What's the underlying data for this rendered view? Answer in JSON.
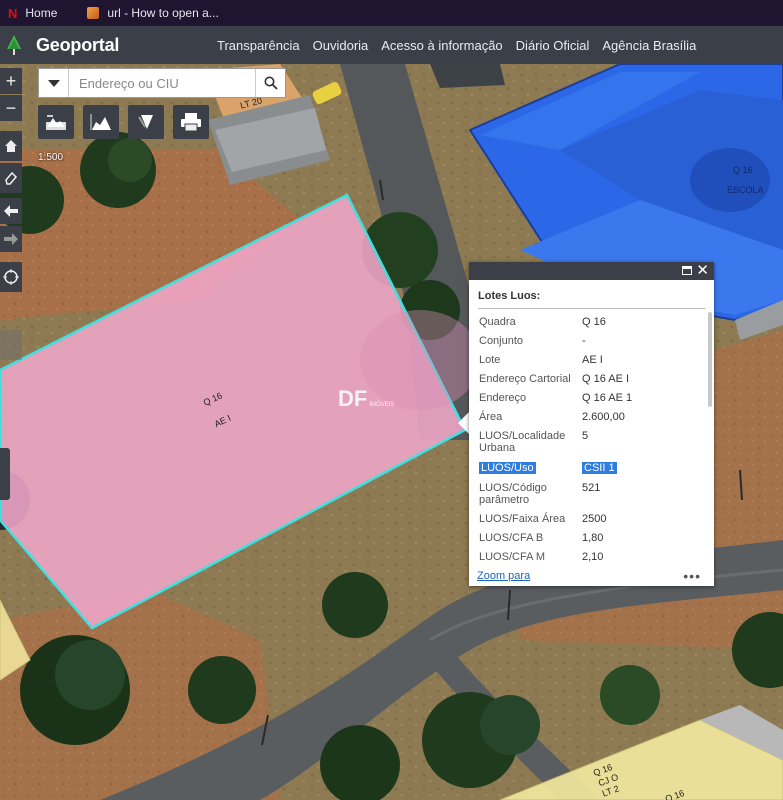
{
  "browser": {
    "tabs": [
      {
        "label": "Home"
      },
      {
        "label": "url - How to open a..."
      }
    ]
  },
  "header": {
    "app_title": "Geoportal",
    "nav": [
      "Transparência",
      "Ouvidoria",
      "Acesso à informação",
      "Diário Oficial",
      "Agência Brasília"
    ]
  },
  "search": {
    "placeholder": "Endereço ou CIU"
  },
  "map": {
    "scale": "1:500",
    "labels": {
      "lt20": "LT 20",
      "school_q": "Q 16",
      "school_name": "ESCOLA",
      "lot_q": "Q 16",
      "lot_ae": "AE I",
      "watermark": "DF",
      "watermark_small": "IMÓVEIS",
      "bl_q": "Q 16",
      "bl_cj": "CJ O",
      "bl_lt": "LT 2",
      "br_q": "Q 16"
    },
    "colors": {
      "selected_lot": "#f0a6c8",
      "selected_outline": "#3ee0e0",
      "school_fill": "#2b67e6",
      "lot_yellow": "#f4eaa0"
    }
  },
  "popup": {
    "title": "Lotes Luos:",
    "rows": [
      {
        "key": "Quadra",
        "value": "Q 16"
      },
      {
        "key": "Conjunto",
        "value": "-"
      },
      {
        "key": "Lote",
        "value": "AE I"
      },
      {
        "key": "Endereço Cartorial",
        "value": "Q 16 AE I"
      },
      {
        "key": "Endereço",
        "value": "Q 16 AE 1"
      },
      {
        "key": "Área",
        "value": "2.600,00"
      },
      {
        "key": "LUOS/Localidade Urbana",
        "value": "5"
      },
      {
        "key": "LUOS/Uso",
        "value": "CSII 1"
      },
      {
        "key": "LUOS/Código parâmetro",
        "value": "521"
      },
      {
        "key": "LUOS/Faixa Área",
        "value": "2500"
      },
      {
        "key": "LUOS/CFA B",
        "value": "1,80"
      },
      {
        "key": "LUOS/CFA M",
        "value": "2,10"
      }
    ],
    "zoom_link": "Zoom para",
    "more": "•••"
  }
}
